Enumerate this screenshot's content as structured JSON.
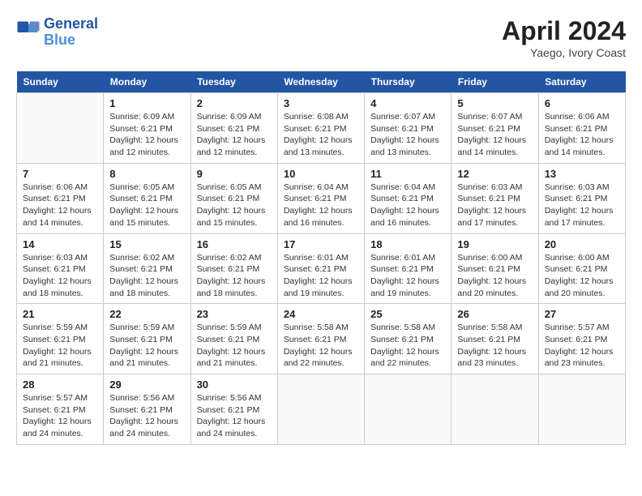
{
  "header": {
    "logo_line1": "General",
    "logo_line2": "Blue",
    "month": "April 2024",
    "location": "Yaego, Ivory Coast"
  },
  "weekdays": [
    "Sunday",
    "Monday",
    "Tuesday",
    "Wednesday",
    "Thursday",
    "Friday",
    "Saturday"
  ],
  "weeks": [
    [
      {
        "day": null
      },
      {
        "day": 1,
        "sunrise": "6:09 AM",
        "sunset": "6:21 PM",
        "daylight": "12 hours and 12 minutes."
      },
      {
        "day": 2,
        "sunrise": "6:09 AM",
        "sunset": "6:21 PM",
        "daylight": "12 hours and 12 minutes."
      },
      {
        "day": 3,
        "sunrise": "6:08 AM",
        "sunset": "6:21 PM",
        "daylight": "12 hours and 13 minutes."
      },
      {
        "day": 4,
        "sunrise": "6:07 AM",
        "sunset": "6:21 PM",
        "daylight": "12 hours and 13 minutes."
      },
      {
        "day": 5,
        "sunrise": "6:07 AM",
        "sunset": "6:21 PM",
        "daylight": "12 hours and 14 minutes."
      },
      {
        "day": 6,
        "sunrise": "6:06 AM",
        "sunset": "6:21 PM",
        "daylight": "12 hours and 14 minutes."
      }
    ],
    [
      {
        "day": 7,
        "sunrise": "6:06 AM",
        "sunset": "6:21 PM",
        "daylight": "12 hours and 14 minutes."
      },
      {
        "day": 8,
        "sunrise": "6:05 AM",
        "sunset": "6:21 PM",
        "daylight": "12 hours and 15 minutes."
      },
      {
        "day": 9,
        "sunrise": "6:05 AM",
        "sunset": "6:21 PM",
        "daylight": "12 hours and 15 minutes."
      },
      {
        "day": 10,
        "sunrise": "6:04 AM",
        "sunset": "6:21 PM",
        "daylight": "12 hours and 16 minutes."
      },
      {
        "day": 11,
        "sunrise": "6:04 AM",
        "sunset": "6:21 PM",
        "daylight": "12 hours and 16 minutes."
      },
      {
        "day": 12,
        "sunrise": "6:03 AM",
        "sunset": "6:21 PM",
        "daylight": "12 hours and 17 minutes."
      },
      {
        "day": 13,
        "sunrise": "6:03 AM",
        "sunset": "6:21 PM",
        "daylight": "12 hours and 17 minutes."
      }
    ],
    [
      {
        "day": 14,
        "sunrise": "6:03 AM",
        "sunset": "6:21 PM",
        "daylight": "12 hours and 18 minutes."
      },
      {
        "day": 15,
        "sunrise": "6:02 AM",
        "sunset": "6:21 PM",
        "daylight": "12 hours and 18 minutes."
      },
      {
        "day": 16,
        "sunrise": "6:02 AM",
        "sunset": "6:21 PM",
        "daylight": "12 hours and 18 minutes."
      },
      {
        "day": 17,
        "sunrise": "6:01 AM",
        "sunset": "6:21 PM",
        "daylight": "12 hours and 19 minutes."
      },
      {
        "day": 18,
        "sunrise": "6:01 AM",
        "sunset": "6:21 PM",
        "daylight": "12 hours and 19 minutes."
      },
      {
        "day": 19,
        "sunrise": "6:00 AM",
        "sunset": "6:21 PM",
        "daylight": "12 hours and 20 minutes."
      },
      {
        "day": 20,
        "sunrise": "6:00 AM",
        "sunset": "6:21 PM",
        "daylight": "12 hours and 20 minutes."
      }
    ],
    [
      {
        "day": 21,
        "sunrise": "5:59 AM",
        "sunset": "6:21 PM",
        "daylight": "12 hours and 21 minutes."
      },
      {
        "day": 22,
        "sunrise": "5:59 AM",
        "sunset": "6:21 PM",
        "daylight": "12 hours and 21 minutes."
      },
      {
        "day": 23,
        "sunrise": "5:59 AM",
        "sunset": "6:21 PM",
        "daylight": "12 hours and 21 minutes."
      },
      {
        "day": 24,
        "sunrise": "5:58 AM",
        "sunset": "6:21 PM",
        "daylight": "12 hours and 22 minutes."
      },
      {
        "day": 25,
        "sunrise": "5:58 AM",
        "sunset": "6:21 PM",
        "daylight": "12 hours and 22 minutes."
      },
      {
        "day": 26,
        "sunrise": "5:58 AM",
        "sunset": "6:21 PM",
        "daylight": "12 hours and 23 minutes."
      },
      {
        "day": 27,
        "sunrise": "5:57 AM",
        "sunset": "6:21 PM",
        "daylight": "12 hours and 23 minutes."
      }
    ],
    [
      {
        "day": 28,
        "sunrise": "5:57 AM",
        "sunset": "6:21 PM",
        "daylight": "12 hours and 24 minutes."
      },
      {
        "day": 29,
        "sunrise": "5:56 AM",
        "sunset": "6:21 PM",
        "daylight": "12 hours and 24 minutes."
      },
      {
        "day": 30,
        "sunrise": "5:56 AM",
        "sunset": "6:21 PM",
        "daylight": "12 hours and 24 minutes."
      },
      {
        "day": null
      },
      {
        "day": null
      },
      {
        "day": null
      },
      {
        "day": null
      }
    ]
  ],
  "labels": {
    "sunrise": "Sunrise:",
    "sunset": "Sunset:",
    "daylight": "Daylight:"
  }
}
